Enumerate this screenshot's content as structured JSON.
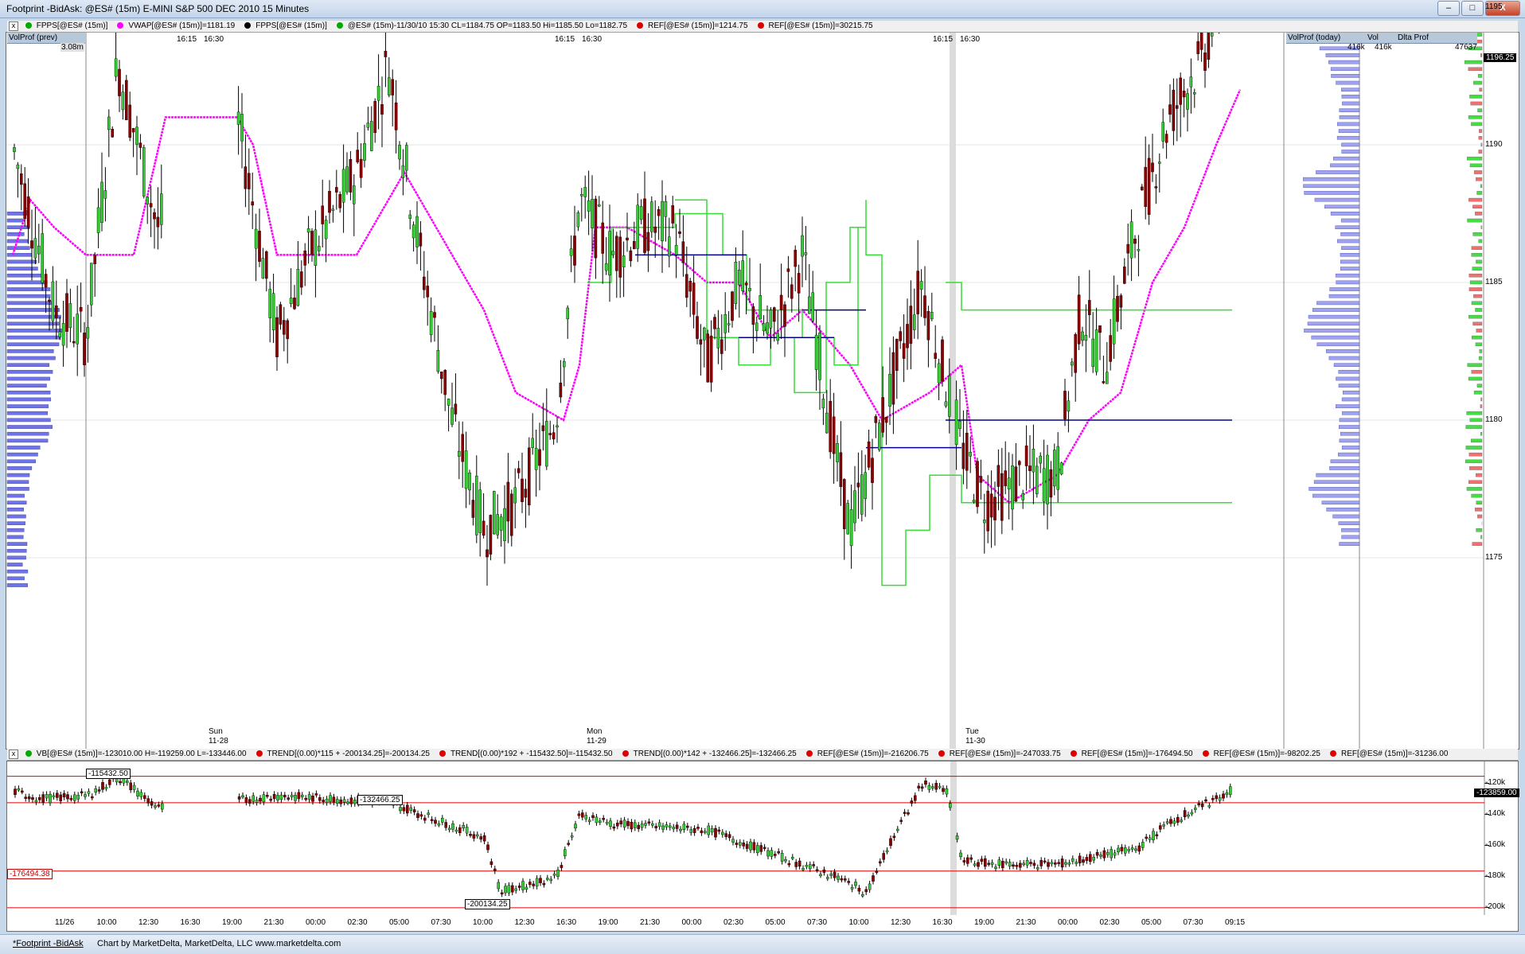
{
  "window": {
    "title": "Footprint  -BidAsk: @ES# (15m) E-MINI S&P 500 DEC 2010 15 Minutes",
    "minimize": "–",
    "maximize": "□",
    "close": "X"
  },
  "main_legend": {
    "items": [
      {
        "label": "FPPS[@ES# (15m)]",
        "color": "#00aa00"
      },
      {
        "label": "VWAP[@ES# (15m)]=1181.19",
        "color": "#ff00ff"
      },
      {
        "label": "FPPS[@ES# (15m)]",
        "color": "#000000"
      },
      {
        "label": "@ES# (15m)-11/30/10 15:30 CL=1184.75 OP=1183.50 Hi=1185.50 Lo=1182.75",
        "color": "#00aa00"
      },
      {
        "label": "REF[@ES# (15m)]=1214.75",
        "color": "#dd0000"
      },
      {
        "label": "REF[@ES# (15m)]=30215.75",
        "color": "#dd0000"
      }
    ]
  },
  "lower_legend": {
    "items": [
      {
        "label": "VB[@ES# (15m)]=-123010.00 H=-119259.00 L=-133446.00",
        "color": "#00aa00"
      },
      {
        "label": "TREND[(0.00)*115 + -200134.25]=-200134.25",
        "color": "#dd0000"
      },
      {
        "label": "TREND[(0.00)*192 + -115432.50]=-115432.50",
        "color": "#dd0000"
      },
      {
        "label": "TREND[(0.00)*142 + -132466.25]=-132466.25",
        "color": "#dd0000"
      },
      {
        "label": "REF[@ES# (15m)]=-216206.75",
        "color": "#dd0000"
      },
      {
        "label": "REF[@ES# (15m)]=-247033.75",
        "color": "#dd0000"
      },
      {
        "label": "REF[@ES# (15m)]=-176494.50",
        "color": "#dd0000"
      },
      {
        "label": "REF[@ES# (15m)]=-98202.25",
        "color": "#dd0000"
      },
      {
        "label": "REF[@ES# (15m)]=-31236.00",
        "color": "#dd0000"
      }
    ]
  },
  "volprof_prev": {
    "title": "VolProf (prev)",
    "value": "3.08m"
  },
  "volprof_today": {
    "title": "VolProf (today)",
    "vol_header": "Vol",
    "delta_header": "Dlta Prof",
    "vol_value": "416k",
    "vol_value2": "416k",
    "delta_value": "47637"
  },
  "price_axis": {
    "ticks": [
      "1195",
      "1190",
      "1185",
      "1180",
      "1175"
    ],
    "current_price": "1196.25"
  },
  "session_labels": [
    "16:15",
    "16:30",
    "16:15",
    "16:30",
    "16:15",
    "16:30"
  ],
  "day_labels": [
    {
      "day": "Sun",
      "date": "11-28"
    },
    {
      "day": "Mon",
      "date": "11-29"
    },
    {
      "day": "Tue",
      "date": "11-30"
    }
  ],
  "lower_axis": {
    "ticks": [
      "-120k",
      "-140k",
      "-160k",
      "-180k",
      "-200k"
    ],
    "current_value": "-123859.00"
  },
  "lower_labels": {
    "a": "-115432.50",
    "b": "-132466.25",
    "c": "-176494.38",
    "d": "-200134.25"
  },
  "time_axis": [
    "11/26",
    "10:00",
    "12:30",
    "16:30",
    "19:00",
    "21:30",
    "00:00",
    "02:30",
    "05:00",
    "07:30",
    "10:00",
    "12:30",
    "16:30",
    "19:00",
    "21:30",
    "00:00",
    "02:30",
    "05:00",
    "07:30",
    "10:00",
    "12:30",
    "16:30",
    "19:00",
    "21:30",
    "00:00",
    "02:30",
    "05:00",
    "07:30",
    "09:15"
  ],
  "status": {
    "tab": "*Footprint -BidAsk",
    "credit": "Chart by MarketDelta, MarketDelta, LLC www.marketdelta.com"
  },
  "colors": {
    "vwap": "#ff00ff",
    "ref_green": "#33dd33",
    "ref_navy": "#00008b",
    "volprof": "#6f73e8",
    "up_candle": "#33cc33",
    "down_candle": "#8b0000",
    "ref_red": "#dd0000"
  }
}
